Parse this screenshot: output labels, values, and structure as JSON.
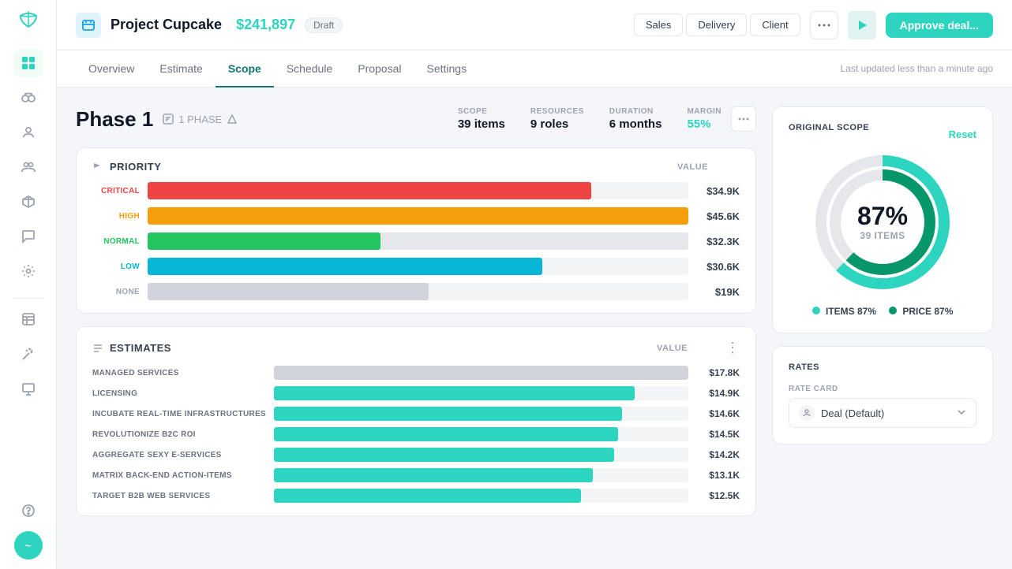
{
  "sidebar": {
    "logo": "~",
    "icons": [
      {
        "name": "grid-icon",
        "symbol": "⊞",
        "active": false
      },
      {
        "name": "binoculars-icon",
        "symbol": "👁",
        "active": false
      },
      {
        "name": "person-icon",
        "symbol": "👤",
        "active": false
      },
      {
        "name": "team-icon",
        "symbol": "👥",
        "active": false
      },
      {
        "name": "box-icon",
        "symbol": "📦",
        "active": false
      },
      {
        "name": "chat-icon",
        "symbol": "💬",
        "active": false
      },
      {
        "name": "gear-icon",
        "symbol": "⚙",
        "active": false
      },
      {
        "name": "table-icon",
        "symbol": "▦",
        "active": false
      },
      {
        "name": "wand-icon",
        "symbol": "✦",
        "active": false
      },
      {
        "name": "monitor-icon",
        "symbol": "🖥",
        "active": false
      }
    ],
    "bottom_icons": [
      {
        "name": "help-icon",
        "symbol": "?"
      },
      {
        "name": "user-avatar",
        "symbol": "~"
      }
    ]
  },
  "header": {
    "icon_symbol": "📋",
    "title": "Project Cupcake",
    "amount": "$241,897",
    "badge": "Draft",
    "tabs": [
      "Sales",
      "Delivery",
      "Client"
    ],
    "approve_label": "Approve deal..."
  },
  "nav": {
    "tabs": [
      "Overview",
      "Estimate",
      "Scope",
      "Schedule",
      "Proposal",
      "Settings"
    ],
    "active_tab": "Scope",
    "last_updated": "Last updated less than a minute ago"
  },
  "phase": {
    "title": "Phase 1",
    "meta_label": "1 PHASE",
    "stats": [
      {
        "label": "SCOPE",
        "value": "39 items"
      },
      {
        "label": "RESOURCES",
        "value": "9 roles"
      },
      {
        "label": "DURATION",
        "value": "6 months"
      },
      {
        "label": "MARGIN",
        "value": "55%",
        "green": true
      }
    ]
  },
  "priority_card": {
    "title": "PRIORITY",
    "value_label": "VALUE",
    "rows": [
      {
        "label": "CRITICAL",
        "bar_pct": 82,
        "bg_pct": 18,
        "amount": "$34.9K",
        "color": "critical"
      },
      {
        "label": "HIGH",
        "bar_pct": 100,
        "bg_pct": 0,
        "amount": "$45.6K",
        "color": "high"
      },
      {
        "label": "NORMAL",
        "bar_pct": 43,
        "bg_pct": 57,
        "amount": "$32.3K",
        "color": "normal"
      },
      {
        "label": "LOW",
        "bar_pct": 73,
        "bg_pct": 27,
        "amount": "$30.6K",
        "color": "low"
      },
      {
        "label": "NONE",
        "bar_pct": 52,
        "bg_pct": 48,
        "amount": "$19K",
        "color": "none"
      }
    ]
  },
  "estimates_card": {
    "title": "ESTIMATES",
    "value_label": "VALUE",
    "rows": [
      {
        "label": "MANAGED SERVICES",
        "bar_pct": 100,
        "amount": "$17.8K",
        "color": "managed"
      },
      {
        "label": "LICENSING",
        "bar_pct": 87,
        "amount": "$14.9K",
        "color": "teal"
      },
      {
        "label": "INCUBATE REAL-TIME INFRASTRUCTURES",
        "bar_pct": 84,
        "amount": "$14.6K",
        "color": "teal"
      },
      {
        "label": "REVOLUTIONIZE B2C ROI",
        "bar_pct": 83,
        "amount": "$14.5K",
        "color": "teal"
      },
      {
        "label": "AGGREGATE SEXY E-SERVICES",
        "bar_pct": 82,
        "amount": "$14.2K",
        "color": "teal"
      },
      {
        "label": "MATRIX BACK-END ACTION-ITEMS",
        "bar_pct": 77,
        "amount": "$13.1K",
        "color": "teal"
      },
      {
        "label": "TARGET B2B WEB SERVICES",
        "bar_pct": 74,
        "amount": "$12.5K",
        "color": "teal"
      }
    ]
  },
  "original_scope": {
    "title": "ORIGINAL SCOPE",
    "reset_label": "Reset",
    "percentage": "87%",
    "items_label": "39 ITEMS",
    "legend": [
      {
        "label": "ITEMS 87%",
        "color": "green"
      },
      {
        "label": "PRICE 87%",
        "color": "darkgreen"
      }
    ]
  },
  "rates": {
    "title": "Rates",
    "rate_card_label": "RATE CARD",
    "rate_card_value": "Deal (Default)",
    "chevron": "⌄"
  },
  "donut": {
    "outer_radius": 85,
    "inner_radius": 60,
    "green_pct": 87,
    "gray_pct": 13
  }
}
